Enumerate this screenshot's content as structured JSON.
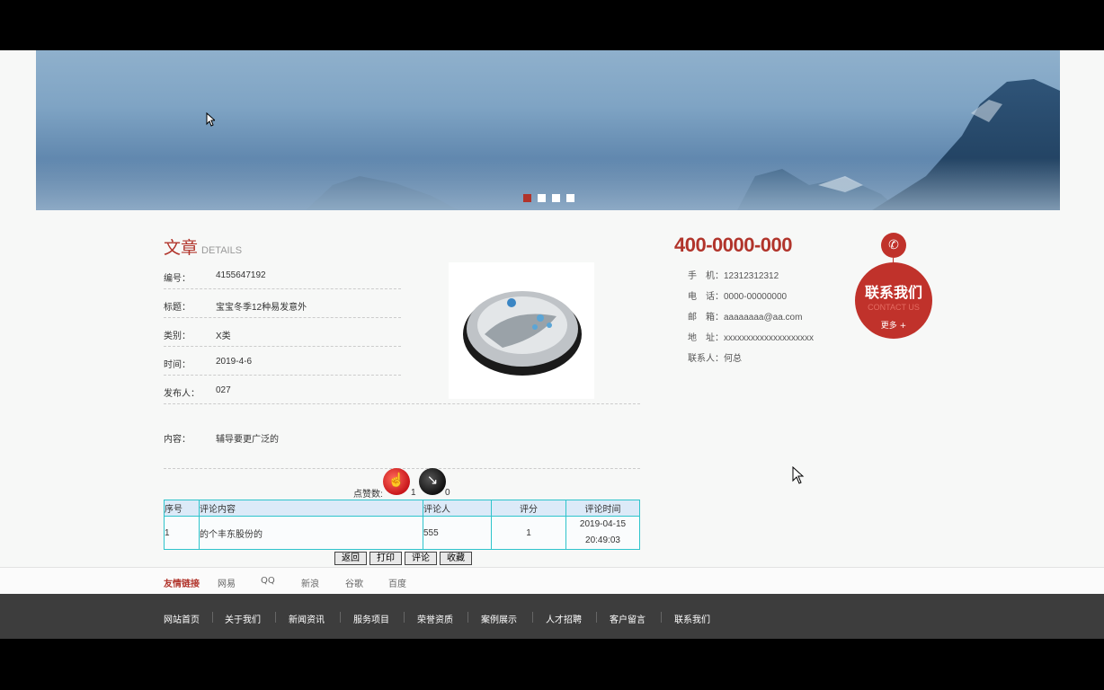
{
  "banner": {
    "slides": 4,
    "active_slide": 1
  },
  "article": {
    "title": "文章",
    "subtitle": "DETAILS",
    "fields": [
      {
        "key": "编号：",
        "value": "4155647192"
      },
      {
        "key": "标题：",
        "value": "宝宝冬季12种易发意外"
      },
      {
        "key": "类别：",
        "value": "X类"
      },
      {
        "key": "时间：",
        "value": "2019-4-6"
      },
      {
        "key": "发布人：",
        "value": "027"
      }
    ],
    "content_key": "内容：",
    "content_value": "辅导要更广泛的"
  },
  "vote": {
    "label": "点赞数:",
    "up_count": "1",
    "down_count": "0"
  },
  "comments": {
    "headers": [
      "序号",
      "评论内容",
      "评论人",
      "评分",
      "评论时间"
    ],
    "rows": [
      {
        "no": "1",
        "content": "的个丰东股份的",
        "user": "555",
        "score": "1",
        "time_date": "2019-04-15",
        "time_clock": "20:49:03"
      }
    ]
  },
  "buttons": {
    "back": "返回",
    "print": "打印",
    "comment": "评论",
    "favorite": "收藏"
  },
  "contact": {
    "hotline": "400-0000-000",
    "mobile": "手　机：12312312312",
    "tel": "电　话：0000-00000000",
    "email": "邮　箱：aaaaaaaa@aa.com",
    "address": "地　址：xxxxxxxxxxxxxxxxxxxx",
    "person": "联系人：何总",
    "badge_title": "联系我们",
    "badge_sub": "CONTACT US",
    "badge_more": "更多 +"
  },
  "links": {
    "title": "友情链接",
    "items": [
      "网易",
      "QQ",
      "新浪",
      "谷歌",
      "百度"
    ]
  },
  "footer": {
    "nav": [
      "网站首页",
      "关于我们",
      "新闻资讯",
      "服务项目",
      "荣誉资质",
      "案例展示",
      "人才招聘",
      "客户留言",
      "联系我们"
    ]
  }
}
